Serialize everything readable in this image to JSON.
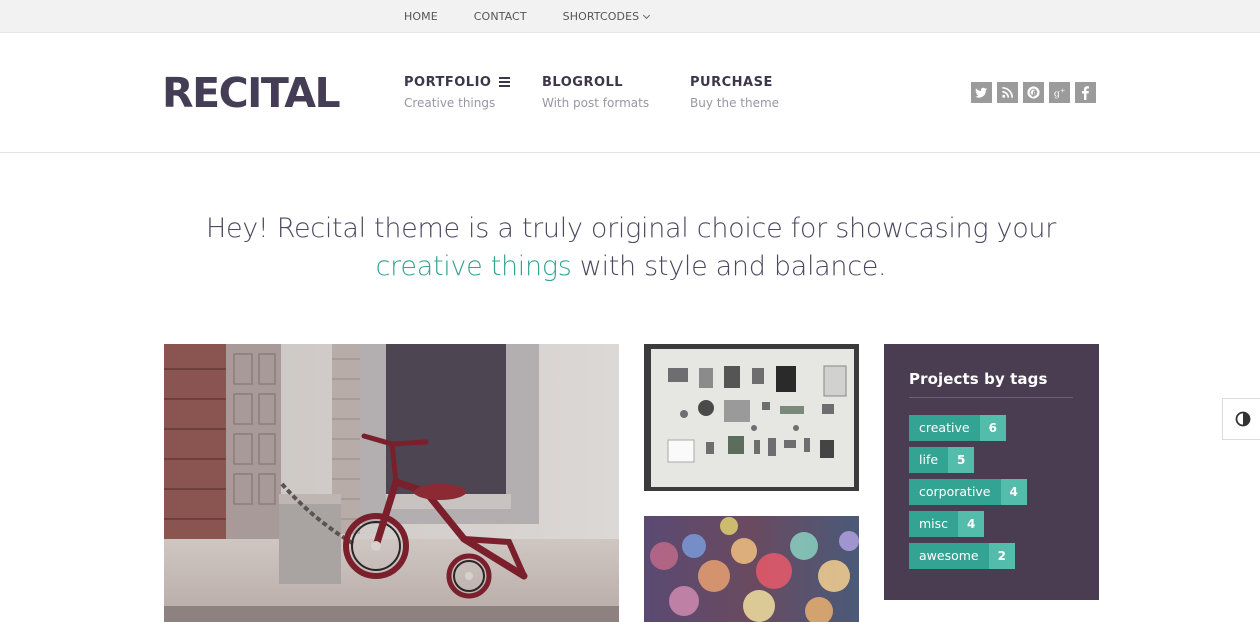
{
  "topbar": {
    "links": [
      {
        "label": "HOME"
      },
      {
        "label": "CONTACT"
      },
      {
        "label": "SHORTCODES"
      }
    ]
  },
  "header": {
    "logo": "RECITAL",
    "nav": [
      {
        "title": "PORTFOLIO",
        "subtitle": "Creative things"
      },
      {
        "title": "BLOGROLL",
        "subtitle": "With post formats"
      },
      {
        "title": "PURCHASE",
        "subtitle": "Buy the theme"
      }
    ],
    "social": [
      "twitter-icon",
      "rss-icon",
      "pinterest-icon",
      "google-plus-icon",
      "facebook-icon"
    ]
  },
  "intro": {
    "part1": "Hey! Recital theme is a truly original choice for showcasing your ",
    "highlight": "creative things",
    "part2": " with style and balance."
  },
  "widget": {
    "title": "Projects by tags",
    "tags": [
      {
        "name": "creative",
        "count": "6"
      },
      {
        "name": "life",
        "count": "5"
      },
      {
        "name": "corporative",
        "count": "4"
      },
      {
        "name": "misc",
        "count": "4"
      },
      {
        "name": "awesome",
        "count": "2"
      }
    ]
  },
  "colors": {
    "accent": "#33a493",
    "accent_light": "#54bcab",
    "widget_bg": "#4a3d52",
    "logo": "#453d55"
  }
}
